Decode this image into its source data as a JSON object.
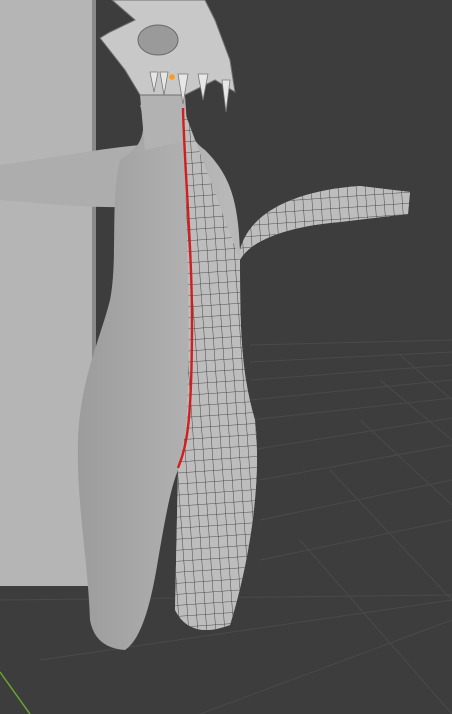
{
  "app": "Blender",
  "editor": "3d-viewport",
  "scene": {
    "mode": "edit-mode",
    "subject": "character-mesh",
    "highlighted_seam": true,
    "mesh_wireframe_side": "right-half"
  },
  "colors": {
    "viewport_bg": "#3d3d3d",
    "grid_line": "#4a4a4a",
    "mesh_surface": "#b0b0b0",
    "wire": "#2a2a2a",
    "seam": "#d21e1e",
    "origin_dot": "#ff9a1a",
    "y_axis": "#6aa62e",
    "side_panel": "#b5b5b5"
  },
  "icons": [
    "origin-dot-icon"
  ]
}
